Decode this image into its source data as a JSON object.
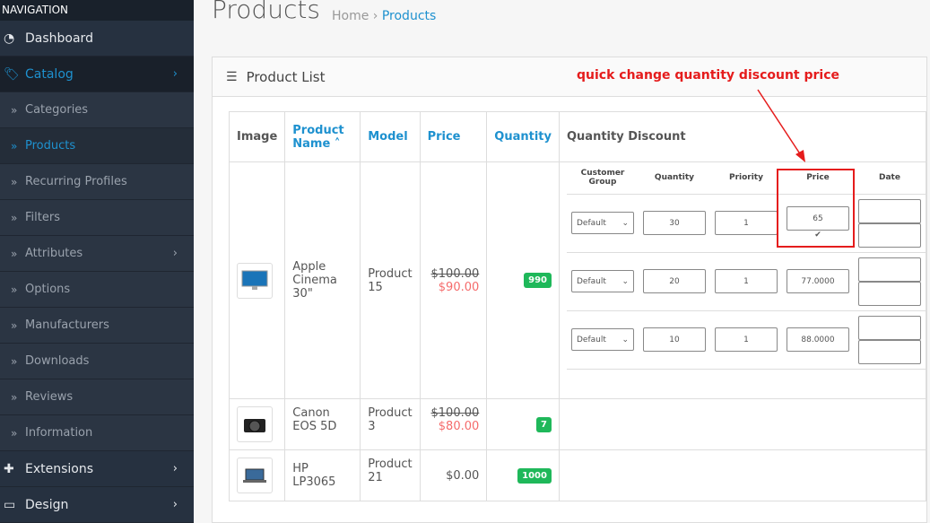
{
  "sidebar": {
    "header": "NAVIGATION",
    "items": [
      {
        "label": "Dashboard",
        "icon": "dashboard-icon"
      },
      {
        "label": "Catalog",
        "icon": "tag-icon"
      },
      {
        "label": "Categories"
      },
      {
        "label": "Products"
      },
      {
        "label": "Recurring Profiles"
      },
      {
        "label": "Filters"
      },
      {
        "label": "Attributes"
      },
      {
        "label": "Options"
      },
      {
        "label": "Manufacturers"
      },
      {
        "label": "Downloads"
      },
      {
        "label": "Reviews"
      },
      {
        "label": "Information"
      },
      {
        "label": "Extensions",
        "icon": "puzzle-icon"
      },
      {
        "label": "Design",
        "icon": "monitor-icon"
      }
    ]
  },
  "page": {
    "title": "Products",
    "breadcrumb": [
      "Home",
      "Products"
    ]
  },
  "panel": {
    "title": "Product List"
  },
  "table": {
    "headers": [
      "Image",
      "Product Name",
      "Model",
      "Price",
      "Quantity",
      "Quantity Discount"
    ],
    "rows": [
      {
        "name": "Apple Cinema 30\"",
        "model": "Product 15",
        "price": "$100.00",
        "special": "$90.00",
        "quantity": "990"
      },
      {
        "name": "Canon EOS 5D",
        "model": "Product 3",
        "price": "$100.00",
        "special": "$80.00",
        "quantity": "7"
      },
      {
        "name": "HP LP3065",
        "model": "Product 21",
        "price": "$0.00",
        "quantity": "1000"
      }
    ]
  },
  "discount": {
    "headers": [
      "Customer Group",
      "Quantity",
      "Priority",
      "Price",
      "Date"
    ],
    "rows": [
      {
        "group": "Default",
        "quantity": "30",
        "priority": "1",
        "price": "65"
      },
      {
        "group": "Default",
        "quantity": "20",
        "priority": "1",
        "price": "77.0000"
      },
      {
        "group": "Default",
        "quantity": "10",
        "priority": "1",
        "price": "88.0000"
      }
    ]
  },
  "annotation": {
    "text": "quick change quantity discount price",
    "color": "#e51c1c"
  },
  "colors": {
    "accent": "#1e91cf",
    "badge": "#1fb85a",
    "special": "#f56b6b"
  }
}
